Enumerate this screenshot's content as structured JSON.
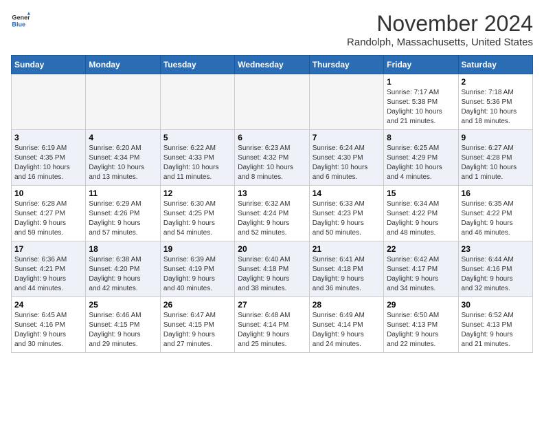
{
  "header": {
    "logo_line1": "General",
    "logo_line2": "Blue",
    "month": "November 2024",
    "location": "Randolph, Massachusetts, United States"
  },
  "weekdays": [
    "Sunday",
    "Monday",
    "Tuesday",
    "Wednesday",
    "Thursday",
    "Friday",
    "Saturday"
  ],
  "weeks": [
    [
      {
        "day": "",
        "info": ""
      },
      {
        "day": "",
        "info": ""
      },
      {
        "day": "",
        "info": ""
      },
      {
        "day": "",
        "info": ""
      },
      {
        "day": "",
        "info": ""
      },
      {
        "day": "1",
        "info": "Sunrise: 7:17 AM\nSunset: 5:38 PM\nDaylight: 10 hours\nand 21 minutes."
      },
      {
        "day": "2",
        "info": "Sunrise: 7:18 AM\nSunset: 5:36 PM\nDaylight: 10 hours\nand 18 minutes."
      }
    ],
    [
      {
        "day": "3",
        "info": "Sunrise: 6:19 AM\nSunset: 4:35 PM\nDaylight: 10 hours\nand 16 minutes."
      },
      {
        "day": "4",
        "info": "Sunrise: 6:20 AM\nSunset: 4:34 PM\nDaylight: 10 hours\nand 13 minutes."
      },
      {
        "day": "5",
        "info": "Sunrise: 6:22 AM\nSunset: 4:33 PM\nDaylight: 10 hours\nand 11 minutes."
      },
      {
        "day": "6",
        "info": "Sunrise: 6:23 AM\nSunset: 4:32 PM\nDaylight: 10 hours\nand 8 minutes."
      },
      {
        "day": "7",
        "info": "Sunrise: 6:24 AM\nSunset: 4:30 PM\nDaylight: 10 hours\nand 6 minutes."
      },
      {
        "day": "8",
        "info": "Sunrise: 6:25 AM\nSunset: 4:29 PM\nDaylight: 10 hours\nand 4 minutes."
      },
      {
        "day": "9",
        "info": "Sunrise: 6:27 AM\nSunset: 4:28 PM\nDaylight: 10 hours\nand 1 minute."
      }
    ],
    [
      {
        "day": "10",
        "info": "Sunrise: 6:28 AM\nSunset: 4:27 PM\nDaylight: 9 hours\nand 59 minutes."
      },
      {
        "day": "11",
        "info": "Sunrise: 6:29 AM\nSunset: 4:26 PM\nDaylight: 9 hours\nand 57 minutes."
      },
      {
        "day": "12",
        "info": "Sunrise: 6:30 AM\nSunset: 4:25 PM\nDaylight: 9 hours\nand 54 minutes."
      },
      {
        "day": "13",
        "info": "Sunrise: 6:32 AM\nSunset: 4:24 PM\nDaylight: 9 hours\nand 52 minutes."
      },
      {
        "day": "14",
        "info": "Sunrise: 6:33 AM\nSunset: 4:23 PM\nDaylight: 9 hours\nand 50 minutes."
      },
      {
        "day": "15",
        "info": "Sunrise: 6:34 AM\nSunset: 4:22 PM\nDaylight: 9 hours\nand 48 minutes."
      },
      {
        "day": "16",
        "info": "Sunrise: 6:35 AM\nSunset: 4:22 PM\nDaylight: 9 hours\nand 46 minutes."
      }
    ],
    [
      {
        "day": "17",
        "info": "Sunrise: 6:36 AM\nSunset: 4:21 PM\nDaylight: 9 hours\nand 44 minutes."
      },
      {
        "day": "18",
        "info": "Sunrise: 6:38 AM\nSunset: 4:20 PM\nDaylight: 9 hours\nand 42 minutes."
      },
      {
        "day": "19",
        "info": "Sunrise: 6:39 AM\nSunset: 4:19 PM\nDaylight: 9 hours\nand 40 minutes."
      },
      {
        "day": "20",
        "info": "Sunrise: 6:40 AM\nSunset: 4:18 PM\nDaylight: 9 hours\nand 38 minutes."
      },
      {
        "day": "21",
        "info": "Sunrise: 6:41 AM\nSunset: 4:18 PM\nDaylight: 9 hours\nand 36 minutes."
      },
      {
        "day": "22",
        "info": "Sunrise: 6:42 AM\nSunset: 4:17 PM\nDaylight: 9 hours\nand 34 minutes."
      },
      {
        "day": "23",
        "info": "Sunrise: 6:44 AM\nSunset: 4:16 PM\nDaylight: 9 hours\nand 32 minutes."
      }
    ],
    [
      {
        "day": "24",
        "info": "Sunrise: 6:45 AM\nSunset: 4:16 PM\nDaylight: 9 hours\nand 30 minutes."
      },
      {
        "day": "25",
        "info": "Sunrise: 6:46 AM\nSunset: 4:15 PM\nDaylight: 9 hours\nand 29 minutes."
      },
      {
        "day": "26",
        "info": "Sunrise: 6:47 AM\nSunset: 4:15 PM\nDaylight: 9 hours\nand 27 minutes."
      },
      {
        "day": "27",
        "info": "Sunrise: 6:48 AM\nSunset: 4:14 PM\nDaylight: 9 hours\nand 25 minutes."
      },
      {
        "day": "28",
        "info": "Sunrise: 6:49 AM\nSunset: 4:14 PM\nDaylight: 9 hours\nand 24 minutes."
      },
      {
        "day": "29",
        "info": "Sunrise: 6:50 AM\nSunset: 4:13 PM\nDaylight: 9 hours\nand 22 minutes."
      },
      {
        "day": "30",
        "info": "Sunrise: 6:52 AM\nSunset: 4:13 PM\nDaylight: 9 hours\nand 21 minutes."
      }
    ]
  ]
}
